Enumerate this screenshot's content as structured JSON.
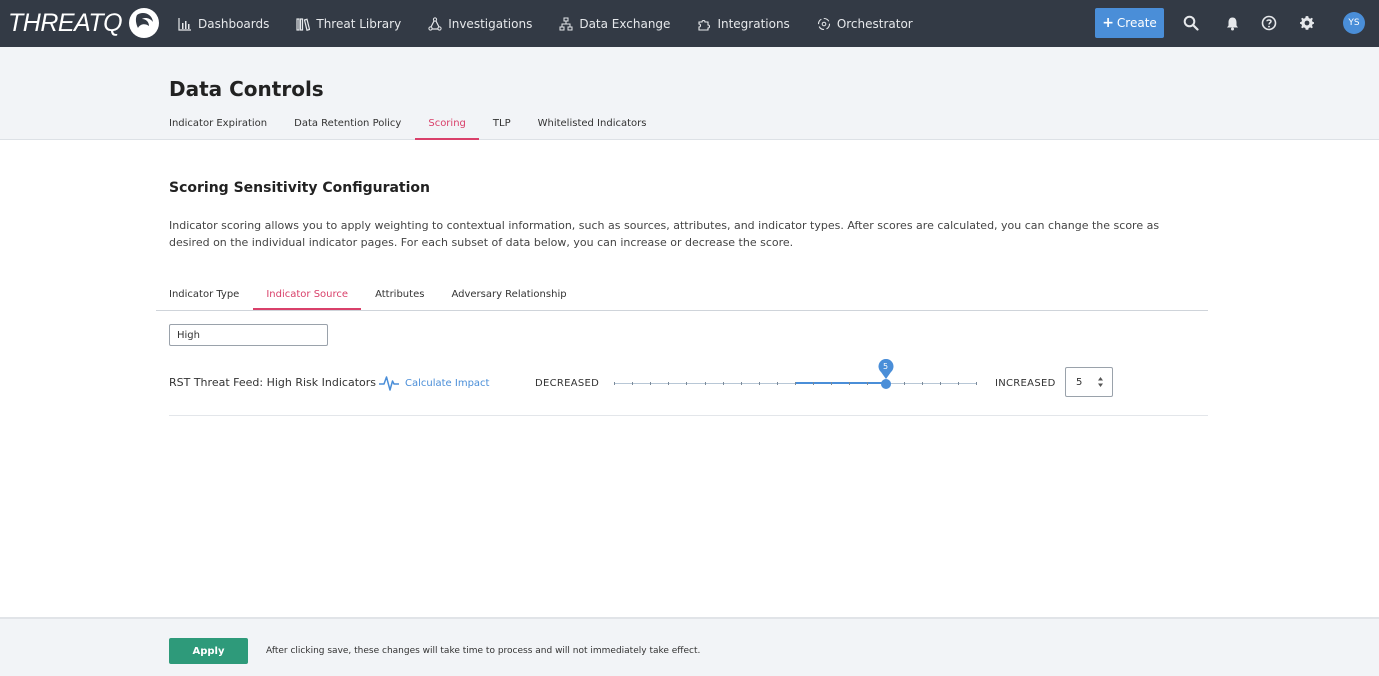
{
  "app": {
    "logo_text": "THREATQ"
  },
  "topnav": {
    "items": [
      {
        "label": "Dashboards",
        "icon": "bar-chart-icon"
      },
      {
        "label": "Threat Library",
        "icon": "library-icon"
      },
      {
        "label": "Investigations",
        "icon": "network-icon"
      },
      {
        "label": "Data Exchange",
        "icon": "sitemap-icon"
      },
      {
        "label": "Integrations",
        "icon": "puzzle-icon"
      },
      {
        "label": "Orchestrator",
        "icon": "orchestrator-icon"
      }
    ],
    "create_label": "Create",
    "avatar_initials": "YS"
  },
  "page": {
    "title": "Data Controls",
    "tabs": [
      {
        "label": "Indicator Expiration",
        "active": false
      },
      {
        "label": "Data Retention Policy",
        "active": false
      },
      {
        "label": "Scoring",
        "active": true
      },
      {
        "label": "TLP",
        "active": false
      },
      {
        "label": "Whitelisted Indicators",
        "active": false
      }
    ]
  },
  "section": {
    "title": "Scoring Sensitivity Configuration",
    "description": "Indicator scoring allows you to apply weighting to contextual information, such as sources, attributes, and indicator types. After scores are calculated, you can change the score as desired on the individual indicator pages. For each subset of data below, you can increase or decrease the score.",
    "sub_tabs": [
      {
        "label": "Indicator Type",
        "active": false
      },
      {
        "label": "Indicator Source",
        "active": true
      },
      {
        "label": "Attributes",
        "active": false
      },
      {
        "label": "Adversary Relationship",
        "active": false
      }
    ],
    "filter_value": "High"
  },
  "scoring_row": {
    "source_name": "RST Threat Feed: High Risk Indicators",
    "calc_label": "Calculate Impact",
    "decreased_label": "DECREASED",
    "increased_label": "INCREASED",
    "slider": {
      "min": -10,
      "max": 10,
      "value": 5,
      "value_label": "5"
    },
    "stepper_value": "5"
  },
  "footer": {
    "apply_label": "Apply",
    "note": "After clicking save, these changes will take time to process and will not immediately take effect."
  },
  "colors": {
    "nav_bg": "#333a45",
    "accent_blue": "#4a8ed8",
    "active_tab": "#d9406a",
    "apply_green": "#2e9a7a"
  }
}
